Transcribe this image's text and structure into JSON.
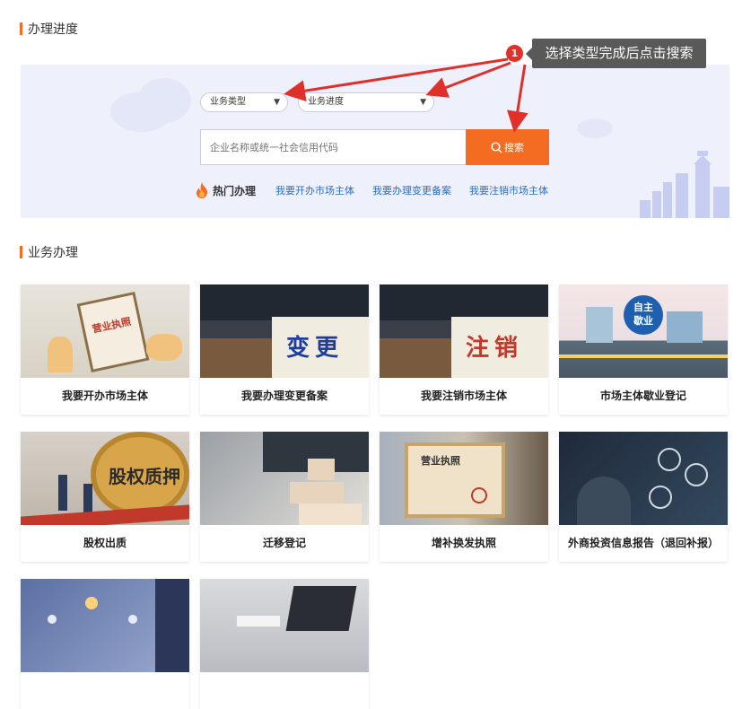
{
  "progress_section": {
    "title": "办理进度"
  },
  "search": {
    "type_select": "业务类型",
    "progress_select": "业务进度",
    "placeholder": "企业名称或统一社会信用代码",
    "button_label": "搜索"
  },
  "hot": {
    "label": "热门办理",
    "links": [
      "我要开办市场主体",
      "我要办理变更备案",
      "我要注销市场主体"
    ]
  },
  "tip": {
    "badge": "1",
    "text": "选择类型完成后点击搜索"
  },
  "business_section": {
    "title": "业务办理"
  },
  "cards": [
    {
      "label": "我要开办市场主体",
      "image_text": "营业执照"
    },
    {
      "label": "我要办理变更备案",
      "image_text": "变更"
    },
    {
      "label": "我要注销市场主体",
      "image_text": "注销"
    },
    {
      "label": "市场主体歇业登记",
      "image_text": "自主歇业"
    },
    {
      "label": "股权出质",
      "image_text": "股权质押"
    },
    {
      "label": "迁移登记",
      "image_text": ""
    },
    {
      "label": "增补换发执照",
      "image_text": "营业执照"
    },
    {
      "label": "外商投资信息报告（退回补报）",
      "image_text": ""
    },
    {
      "label": "",
      "image_text": ""
    },
    {
      "label": "",
      "image_text": ""
    }
  ],
  "colors": {
    "accent": "#f36c21",
    "link": "#2a6ec7",
    "panel_bg": "#eef0fc",
    "tip_bg": "#595959",
    "badge": "#e0302a"
  }
}
